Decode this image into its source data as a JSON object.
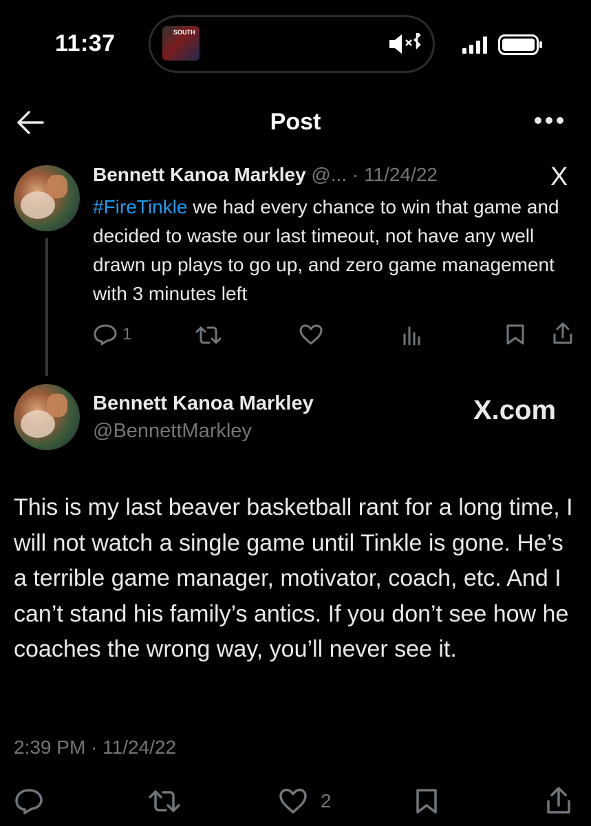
{
  "status_bar": {
    "time": "11:37",
    "island_thumb_text": "SOUTH",
    "icons": [
      "mute-icon",
      "bluetooth-icon",
      "signal-icon",
      "battery-icon"
    ]
  },
  "header": {
    "title": "Post",
    "back_icon": "back-arrow-icon",
    "more_icon": "more-icon"
  },
  "quoted_post": {
    "author_name": "Bennett Kanoa Markley",
    "meta": "@... · 11/24/22",
    "hashtag": "#FireTinkle",
    "text": " we had every chance to win that game and decided to waste our last timeout, not have any well drawn up plays to go up, and zero game management with 3 minutes left",
    "reply_count": "1",
    "like_count": "",
    "logo": "X"
  },
  "main_post": {
    "author_name": "Bennett Kanoa Markley",
    "handle": "@BennettMarkley",
    "watermark": "X.com",
    "text": "This is my last beaver basketball rant for a long time, I will not watch a single game until Tinkle is gone. He’s a terrible game manager, motivator, coach, etc. And I can’t stand his family’s antics. If you don’t see how he coaches the wrong way, you’ll never see it.",
    "timestamp": "2:39 PM · 11/24/22",
    "like_count": "2"
  },
  "colors": {
    "background": "#000000",
    "text": "#e7e9ea",
    "secondary": "#71767b",
    "link": "#1d9bf0"
  }
}
